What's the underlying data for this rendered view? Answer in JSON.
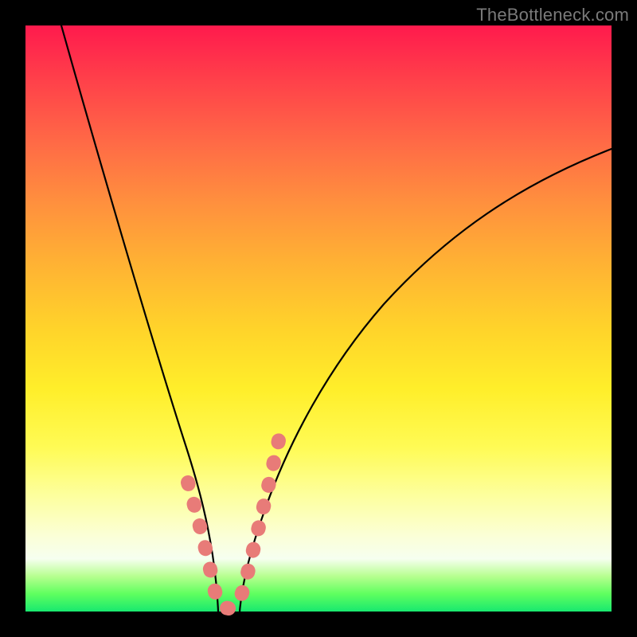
{
  "watermark": "TheBottleneck.com",
  "colors": {
    "frame_bg": "#000000",
    "watermark": "#7a7a7a",
    "curve": "#000000",
    "hairpin": "#e87b78"
  },
  "chart_data": {
    "type": "line",
    "title": "",
    "xlabel": "",
    "ylabel": "",
    "xlim": [
      0,
      100
    ],
    "ylim": [
      0,
      100
    ],
    "series": [
      {
        "name": "left-curve",
        "x": [
          6,
          8.4,
          11,
          13.6,
          16.2,
          18.8,
          21.4,
          24,
          25.5,
          27,
          28.4,
          29.3,
          30.2,
          31.1,
          32.0,
          32.9
        ],
        "y": [
          100,
          91,
          81.5,
          72,
          62.5,
          53,
          44,
          35,
          29.5,
          24,
          18.5,
          14.5,
          10.5,
          7,
          3.5,
          0
        ]
      },
      {
        "name": "right-curve",
        "x": [
          36.6,
          37.8,
          39.1,
          40.5,
          42.5,
          44.9,
          47.6,
          50.7,
          54.1,
          58.2,
          62.6,
          67.4,
          72.6,
          78.1,
          84.0,
          90.2,
          96.9,
          100
        ],
        "y": [
          0,
          4.2,
          9,
          14.3,
          20.8,
          27.9,
          34.6,
          41,
          46.9,
          52.7,
          57.9,
          62.4,
          66.4,
          69.9,
          73,
          75.7,
          78.1,
          79
        ]
      },
      {
        "name": "hairpin-dots-left",
        "x": [
          27.7,
          28.8,
          29.3,
          30.1,
          31.0,
          31.1,
          31.7,
          32.2
        ],
        "y": [
          22,
          17.5,
          15,
          11.5,
          7.5,
          6.5,
          4,
          2.3
        ]
      },
      {
        "name": "hairpin-dots-bottom",
        "x": [
          32.6,
          34.0,
          35.2,
          36.4
        ],
        "y": [
          0.7,
          0.3,
          0.3,
          0.7
        ]
      },
      {
        "name": "hairpin-dots-right",
        "x": [
          37.1,
          37.6,
          38.2,
          38.9,
          39.6,
          40.4,
          41.3,
          42.4,
          43.5
        ],
        "y": [
          2.5,
          5,
          8,
          11.5,
          15,
          18.5,
          22.5,
          27,
          30.5
        ]
      }
    ]
  }
}
